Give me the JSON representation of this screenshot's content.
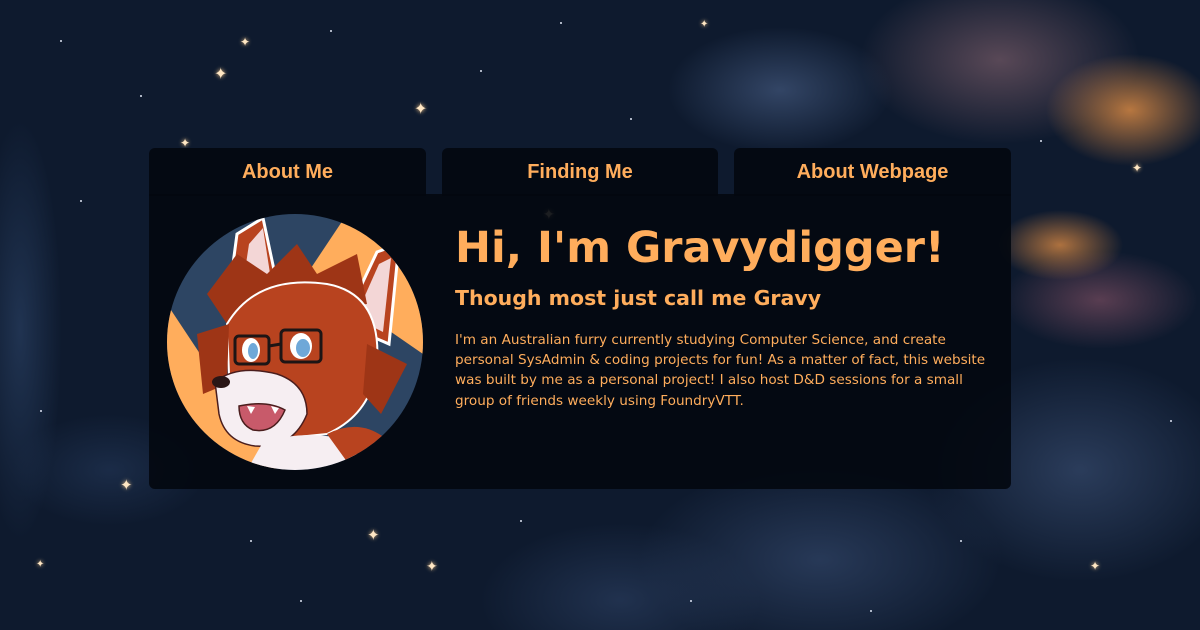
{
  "nav": {
    "tabs": [
      {
        "label": "About Me"
      },
      {
        "label": "Finding Me"
      },
      {
        "label": "About Webpage"
      }
    ]
  },
  "hero": {
    "title": "Hi, I'm Gravydigger!",
    "subtitle": "Though most just call me Gravy",
    "bio": "I'm an Australian furry currently studying Computer Science, and create personal SysAdmin & coding projects for fun! As a matter of fact, this website was built by me as a personal project! I also host D&D sessions for a small group of friends weekly using FoundryVTT."
  },
  "colors": {
    "accent": "#ffad5c",
    "panel": "#03080f",
    "space": "#0e1a2e",
    "fur": "#b8431f"
  }
}
